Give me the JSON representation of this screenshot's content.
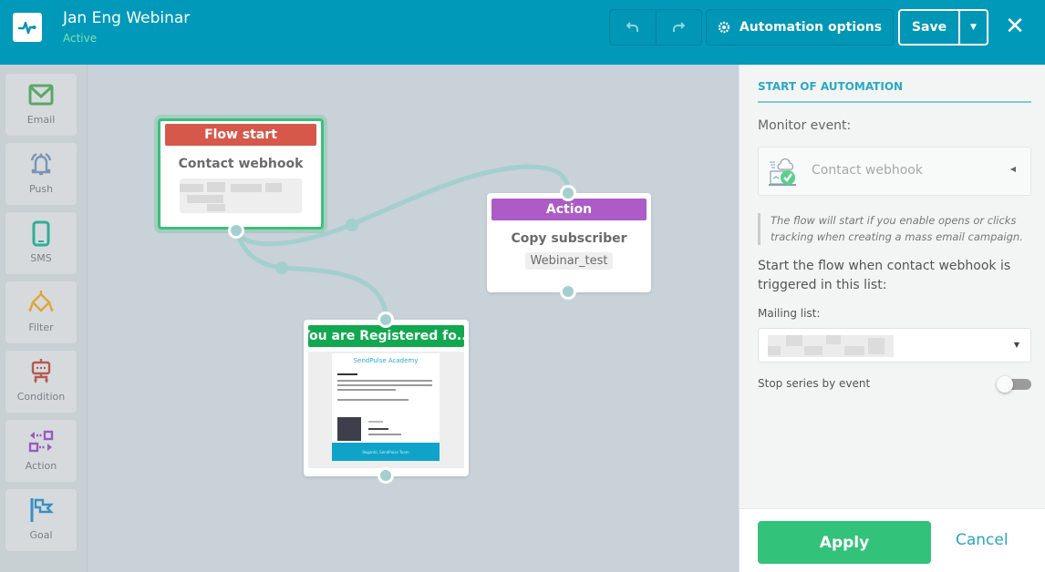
{
  "header": {
    "title": "Jan Eng Webinar",
    "status": "Active",
    "undo_icon": "undo-icon",
    "redo_icon": "redo-icon",
    "automation_options_label": "Automation options",
    "save_label": "Save",
    "close_icon": "close-icon",
    "colors": {
      "bar": "#0099ba",
      "status": "#7fe0a8"
    }
  },
  "palette": {
    "items": [
      {
        "label": "Email",
        "icon": "envelope-icon",
        "color": "#5aa865"
      },
      {
        "label": "Push",
        "icon": "bell-icon",
        "color": "#7a95b4"
      },
      {
        "label": "SMS",
        "icon": "phone-icon",
        "color": "#2fae98"
      },
      {
        "label": "Filter",
        "icon": "filter-icon",
        "color": "#e0a53a"
      },
      {
        "label": "Condition",
        "icon": "condition-icon",
        "color": "#b55a52"
      },
      {
        "label": "Action",
        "icon": "action-icon",
        "color": "#9a5bbf"
      },
      {
        "label": "Goal",
        "icon": "flag-icon",
        "color": "#3a8fc4"
      }
    ]
  },
  "canvas": {
    "nodes": {
      "flow_start": {
        "header": "Flow start",
        "title": "Contact webhook",
        "value": "",
        "color": "#d6584b"
      },
      "action": {
        "header": "Action",
        "title": "Copy subscriber",
        "value": "Webinar_test",
        "color": "#ad5bc6"
      },
      "email": {
        "header": "You are Registered fo...",
        "color": "#12a84f",
        "preview": {
          "brand": "SendPulse Academy",
          "heading": "Thank you!",
          "body": "You have registered for the Getting Started with SendPulse webinar on 16.1.2020 at 12 PM EST. We will send you a reminder email on the day of the webinar.",
          "closing": "I am looking forward to talking with you!",
          "speaker_label": "Speaker:",
          "speaker_name": "Caleb Smith,",
          "speaker_role": "SendPulse Marketer",
          "footer_band": "Regards, SendPulse Team"
        }
      }
    }
  },
  "panel": {
    "section_title": "START OF AUTOMATION",
    "monitor_label": "Monitor event:",
    "event": {
      "value": "Contact webhook",
      "icon": "webhook-cloud-icon"
    },
    "note": "The flow will start if you enable opens or clicks tracking when creating a mass email campaign.",
    "start_flow_text": "Start the flow when contact webhook is triggered in this list:",
    "mailing_label": "Mailing list:",
    "mailing_value": "",
    "stop_label": "Stop series by event",
    "stop_enabled": false,
    "apply_label": "Apply",
    "cancel_label": "Cancel",
    "colors": {
      "accent": "#2aa9c4",
      "apply": "#33c27a"
    }
  }
}
